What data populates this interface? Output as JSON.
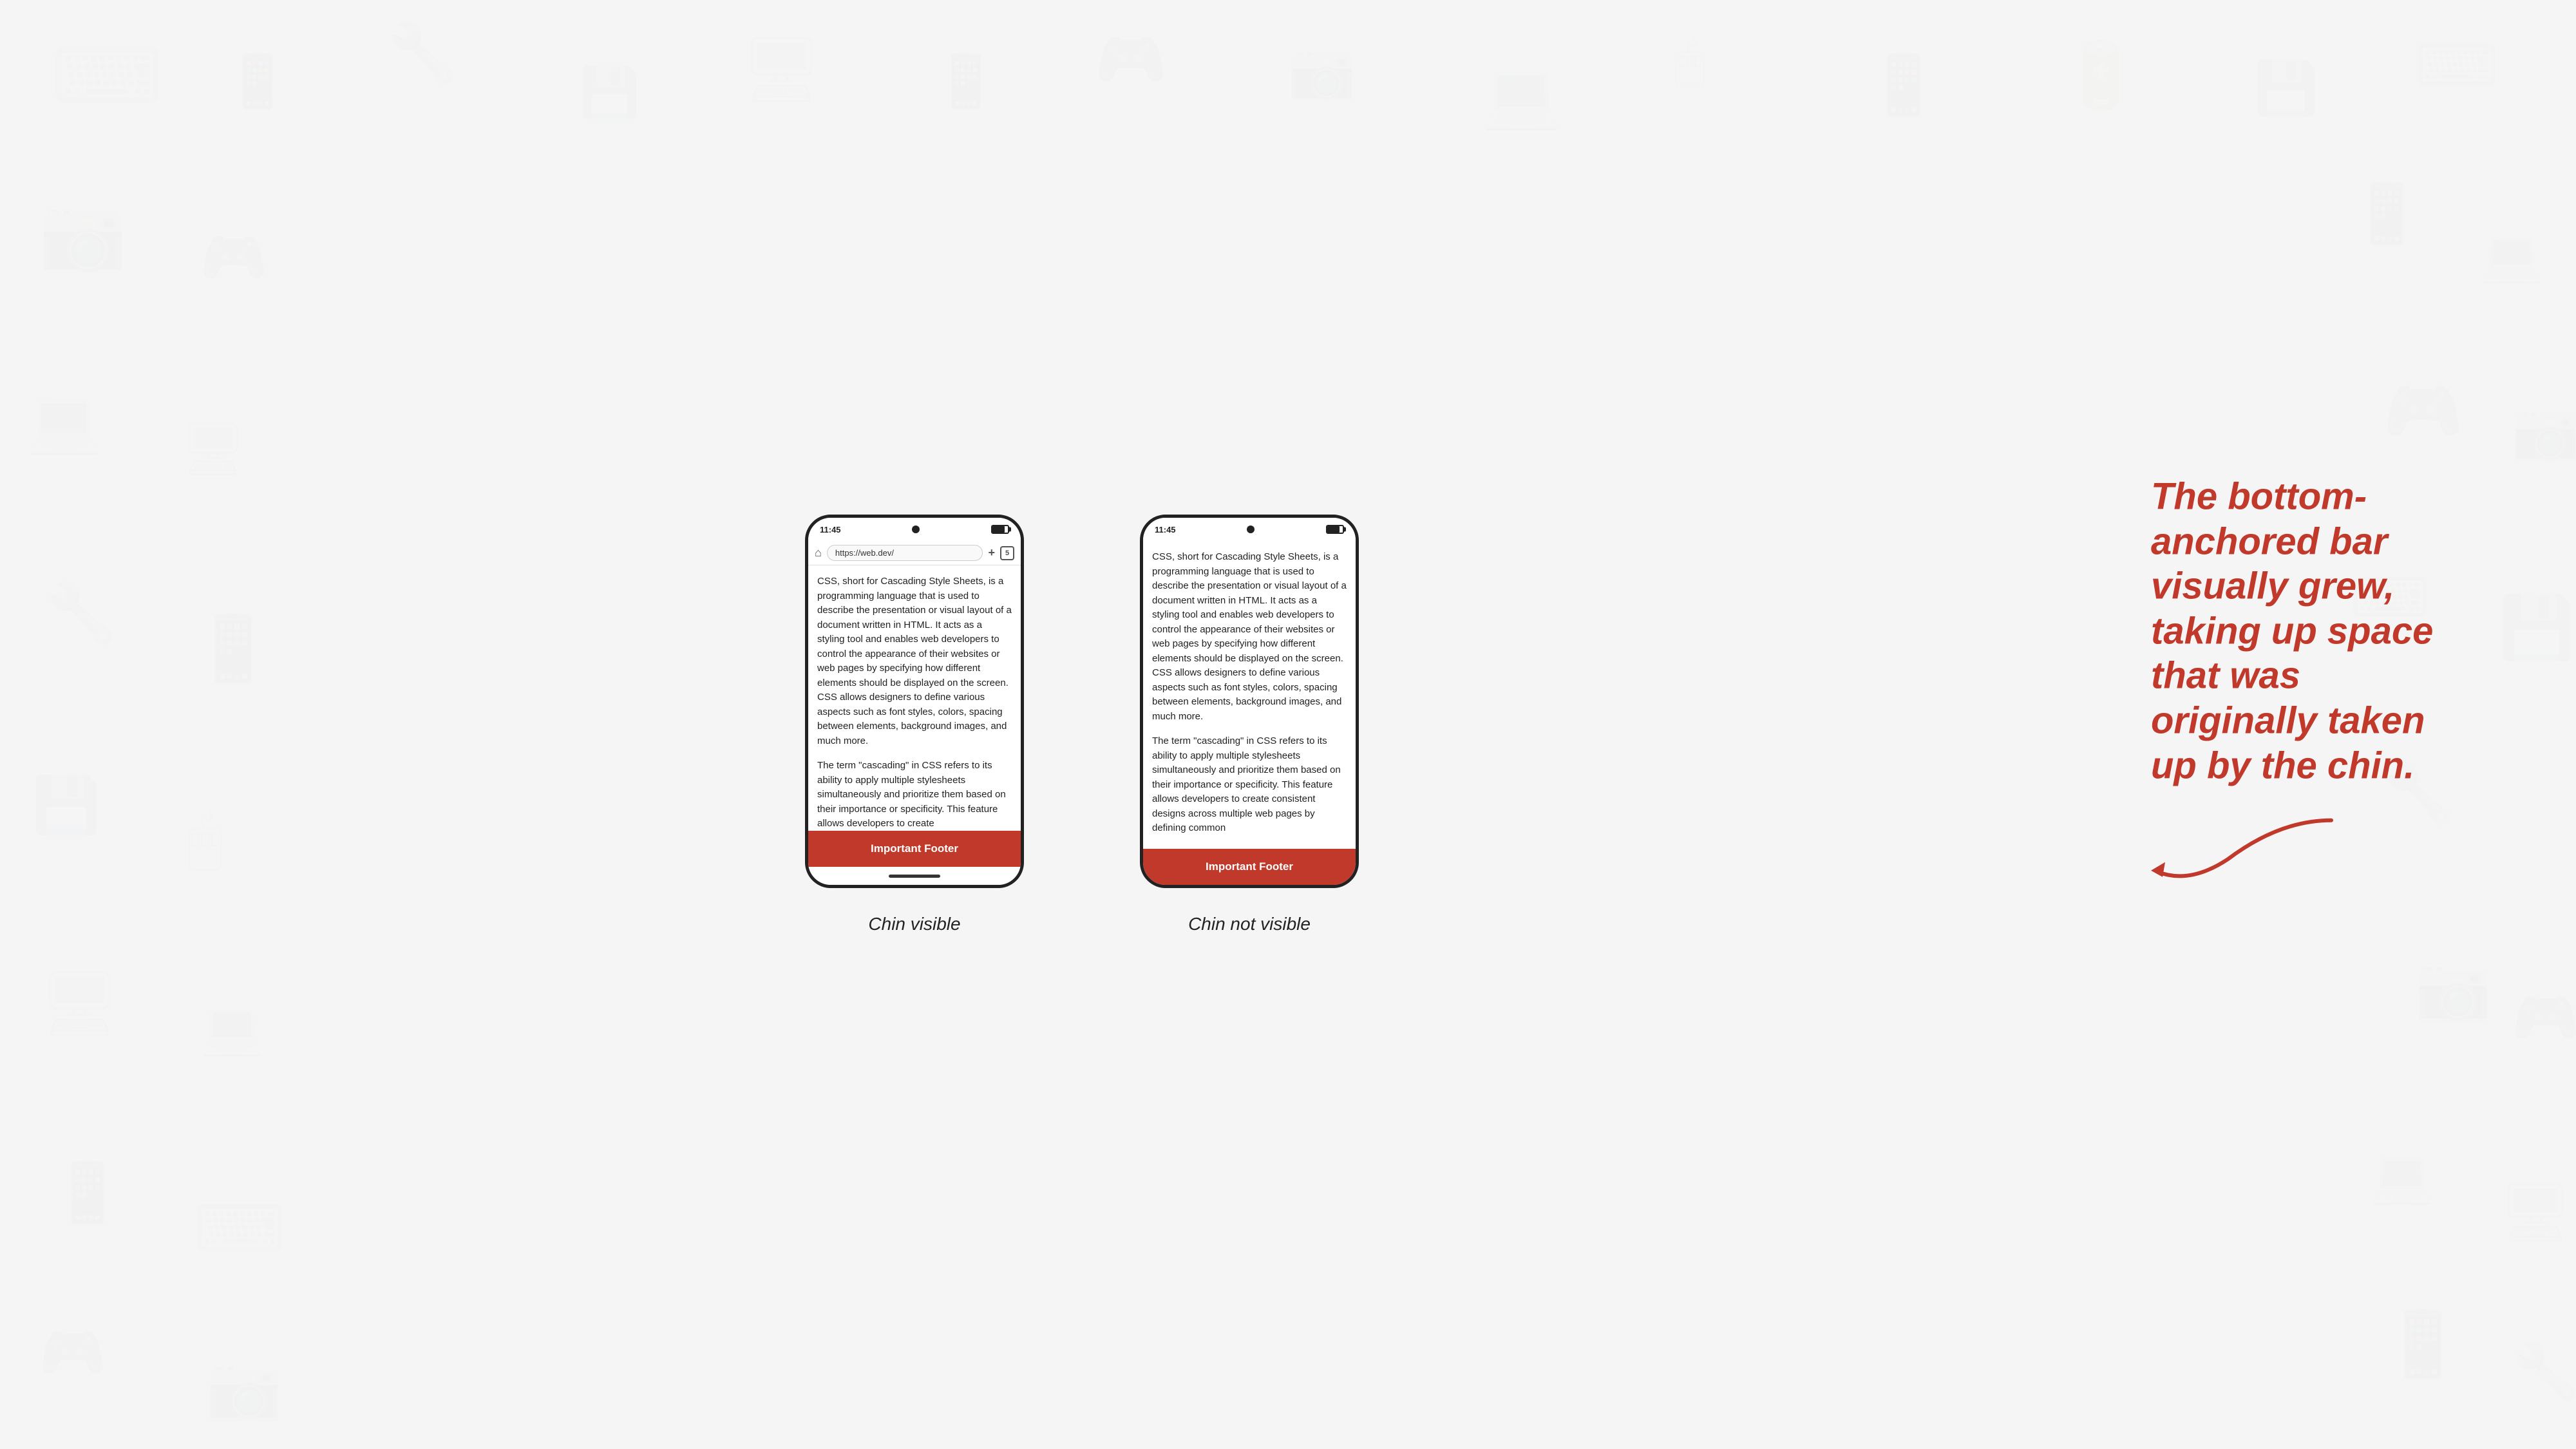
{
  "background": {
    "color": "#f5f5f5"
  },
  "phones": [
    {
      "id": "chin-visible",
      "status_bar": {
        "time": "11:45",
        "camera": true,
        "battery": true
      },
      "has_address_bar": true,
      "address_bar": {
        "url": "https://web.dev/",
        "tab_count": "5"
      },
      "content_paragraphs": [
        "CSS, short for Cascading Style Sheets, is a programming language that is used to describe the presentation or visual layout of a document written in HTML. It acts as a styling tool and enables web developers to control the appearance of their websites or web pages by specifying how different elements should be displayed on the screen. CSS allows designers to define various aspects such as font styles, colors, spacing between elements, background images, and much more.",
        "The term \"cascading\" in CSS refers to its ability to apply multiple stylesheets simultaneously and prioritize them based on their importance or specificity. This feature allows developers to create"
      ],
      "footer_label": "Important Footer",
      "has_chin": true,
      "caption": "Chin visible"
    },
    {
      "id": "chin-not-visible",
      "status_bar": {
        "time": "11:45",
        "camera": true,
        "battery": true
      },
      "has_address_bar": false,
      "content_paragraphs": [
        "CSS, short for Cascading Style Sheets, is a programming language that is used to describe the presentation or visual layout of a document written in HTML. It acts as a styling tool and enables web developers to control the appearance of their websites or web pages by specifying how different elements should be displayed on the screen. CSS allows designers to define various aspects such as font styles, colors, spacing between elements, background images, and much more.",
        "The term \"cascading\" in CSS refers to its ability to apply multiple stylesheets simultaneously and prioritize them based on their importance or specificity. This feature allows developers to create consistent designs across multiple web pages by defining common"
      ],
      "footer_label": "Important Footer",
      "has_chin": false,
      "caption": "Chin not visible"
    }
  ],
  "annotation": {
    "lines": [
      "The bottom-",
      "anchored bar",
      "visually grew,",
      "taking up space",
      "that was",
      "originally taken",
      "up by the chin."
    ],
    "color": "#c0392b"
  },
  "toolbar": {}
}
